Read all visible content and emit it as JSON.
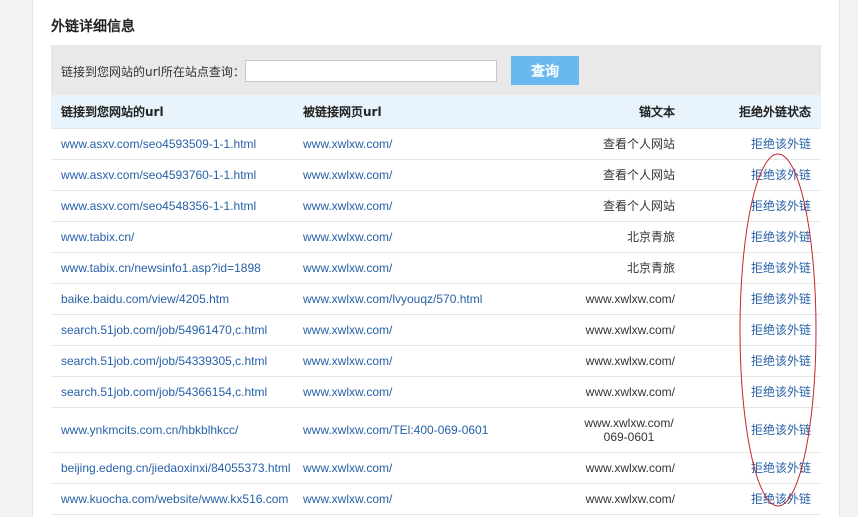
{
  "section": {
    "title": "外链详细信息"
  },
  "search": {
    "label": "链接到您网站的url所在站点查询：",
    "value": "",
    "placeholder": "",
    "button_label": "查询"
  },
  "table": {
    "headers": {
      "source_url": "链接到您网站的url",
      "target_url": "被链接网页url",
      "anchor_text": "锚文本",
      "reject_status": "拒绝外链状态"
    },
    "rows": [
      {
        "source": "www.asxv.com/seo4593509-1-1.html",
        "target": "www.xwlxw.com/",
        "anchor": "查看个人网站",
        "action": "拒绝该外链"
      },
      {
        "source": "www.asxv.com/seo4593760-1-1.html",
        "target": "www.xwlxw.com/",
        "anchor": "查看个人网站",
        "action": "拒绝该外链"
      },
      {
        "source": "www.asxv.com/seo4548356-1-1.html",
        "target": "www.xwlxw.com/",
        "anchor": "查看个人网站",
        "action": "拒绝该外链"
      },
      {
        "source": "www.tabix.cn/",
        "target": "www.xwlxw.com/",
        "anchor": "北京青旅",
        "action": "拒绝该外链"
      },
      {
        "source": "www.tabix.cn/newsinfo1.asp?id=1898",
        "target": "www.xwlxw.com/",
        "anchor": "北京青旅",
        "action": "拒绝该外链"
      },
      {
        "source": "baike.baidu.com/view/4205.htm",
        "target": "www.xwlxw.com/lvyouqz/570.html",
        "anchor": "www.xwlxw.com/",
        "action": "拒绝该外链"
      },
      {
        "source": "search.51job.com/job/54961470,c.html",
        "target": "www.xwlxw.com/",
        "anchor": "www.xwlxw.com/",
        "action": "拒绝该外链"
      },
      {
        "source": "search.51job.com/job/54339305,c.html",
        "target": "www.xwlxw.com/",
        "anchor": "www.xwlxw.com/",
        "action": "拒绝该外链"
      },
      {
        "source": "search.51job.com/job/54366154,c.html",
        "target": "www.xwlxw.com/",
        "anchor": "www.xwlxw.com/",
        "action": "拒绝该外链"
      },
      {
        "source": "www.ynkmcits.com.cn/hbkblhkcc/",
        "target": "www.xwlxw.com/TEl:400-069-0601",
        "anchor": "www.xwlxw.com/ 069-0601",
        "action": "拒绝该外链"
      },
      {
        "source": "beijing.edeng.cn/jiedaoxinxi/84055373.html",
        "target": "www.xwlxw.com/",
        "anchor": "www.xwlxw.com/",
        "action": "拒绝该外链"
      },
      {
        "source": "www.kuocha.com/website/www.kx516.com",
        "target": "www.xwlxw.com/",
        "anchor": "www.xwlxw.com/",
        "action": "拒绝该外链"
      }
    ]
  },
  "colors": {
    "link": "#2861a8",
    "header_bg": "#e8f3fb",
    "search_bar_bg": "#e9e9e9",
    "button_bg": "#6ab8f0",
    "annotation_ellipse": "#c0272d"
  }
}
